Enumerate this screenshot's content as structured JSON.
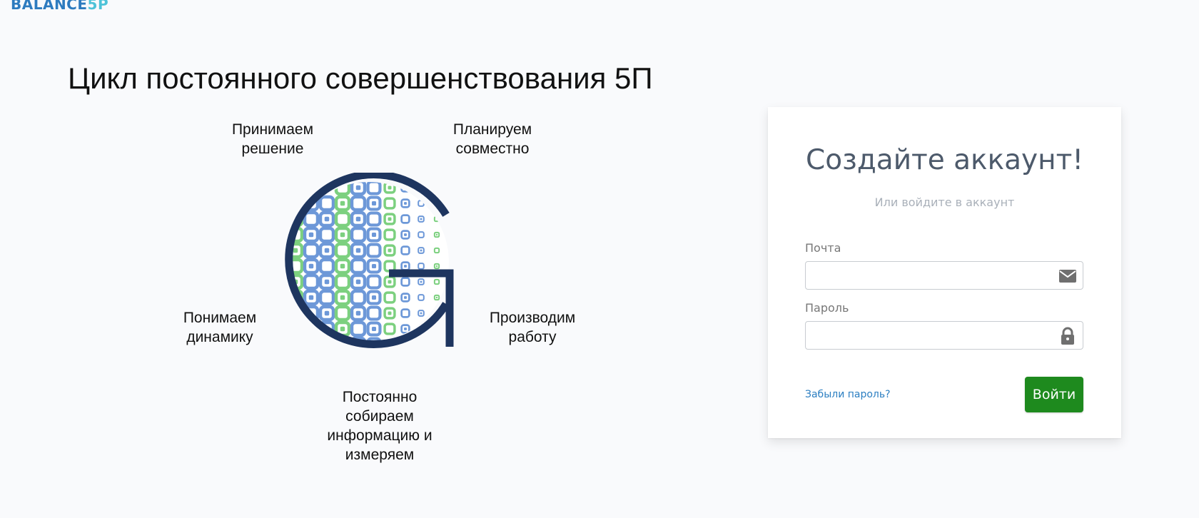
{
  "brand": {
    "logo_part1": "BALANCE",
    "logo_part2": "5P",
    "color_primary": "#2d7bbf",
    "color_accent": "#4dc3d8"
  },
  "hero": {
    "title": "Цикл постоянного совершенствования 5П",
    "cycle": {
      "decide": [
        "Принимаем",
        "решение"
      ],
      "plan": [
        "Планируем",
        "совместно"
      ],
      "understand": [
        "Понимаем",
        "динамику"
      ],
      "produce": [
        "Производим",
        "работу"
      ],
      "collect": [
        "Постоянно",
        "собираем",
        "информацию и",
        "измеряем"
      ]
    },
    "globe_colors": {
      "ring": "#1e355f",
      "blue": "#6d98d8",
      "green": "#7cd07f"
    }
  },
  "login": {
    "title": "Создайте аккаунт!",
    "subtitle": "Или войдите в аккаунт",
    "email_label": "Почта",
    "email_value": "",
    "email_icon": "envelope-icon",
    "password_label": "Пароль",
    "password_value": "",
    "password_icon": "lock-icon",
    "forgot_link": "Забыли пароль?",
    "submit_label": "Войти",
    "submit_color": "#1e8a1e",
    "link_color": "#2b7ec1"
  }
}
